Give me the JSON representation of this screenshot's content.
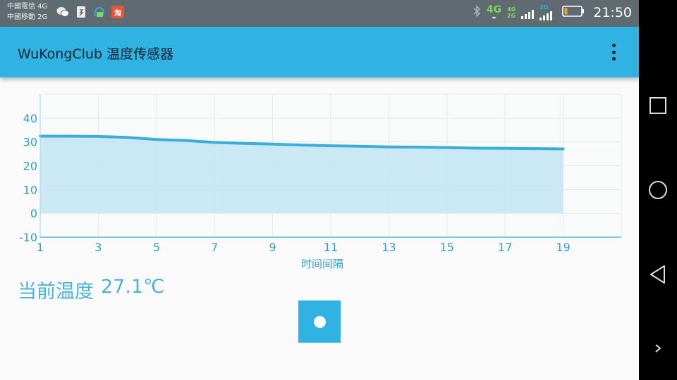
{
  "status_bar": {
    "carrier_1": "中國電信 4G",
    "carrier_2": "中國移動 2G",
    "network_1": "4G",
    "network_2a": "4G",
    "network_2b": "2G",
    "network_3": "2G",
    "time": "21:50",
    "icons": [
      "wechat-icon",
      "sim-manager-icon",
      "mail-icon",
      "taobao-icon",
      "bluetooth-icon",
      "signal-icon",
      "battery-icon"
    ]
  },
  "app_bar": {
    "title": "WuKongClub 温度传感器",
    "menu_icon": "more-vert-icon"
  },
  "chart_data": {
    "type": "area",
    "x": [
      1,
      2,
      3,
      4,
      5,
      6,
      7,
      8,
      9,
      10,
      11,
      12,
      13,
      14,
      15,
      16,
      17,
      18,
      19
    ],
    "values": [
      32.4,
      32.4,
      32.3,
      31.9,
      31.0,
      30.6,
      29.8,
      29.4,
      29.1,
      28.7,
      28.4,
      28.2,
      27.9,
      27.8,
      27.6,
      27.4,
      27.3,
      27.2,
      27.1
    ],
    "xlabel": "时间间隔",
    "ylabel": "",
    "x_ticks": [
      1,
      3,
      5,
      7,
      9,
      11,
      13,
      15,
      17,
      19
    ],
    "y_ticks": [
      -10,
      0,
      10,
      20,
      30,
      40
    ],
    "xlim": [
      1,
      21
    ],
    "ylim": [
      -10,
      50
    ],
    "grid": true,
    "line_color": "#3aaedb",
    "fill_color": "#c5e6f4"
  },
  "current": {
    "label": "当前温度",
    "value": "27.1℃"
  },
  "colors": {
    "accent": "#30b2e3",
    "status_bar": "#5f6b70",
    "text_accent": "#4bb4d6"
  },
  "nav_bar": {
    "icons": [
      "recents-square-icon",
      "home-circle-icon",
      "back-triangle-icon",
      "expand-chevron-icon"
    ]
  }
}
